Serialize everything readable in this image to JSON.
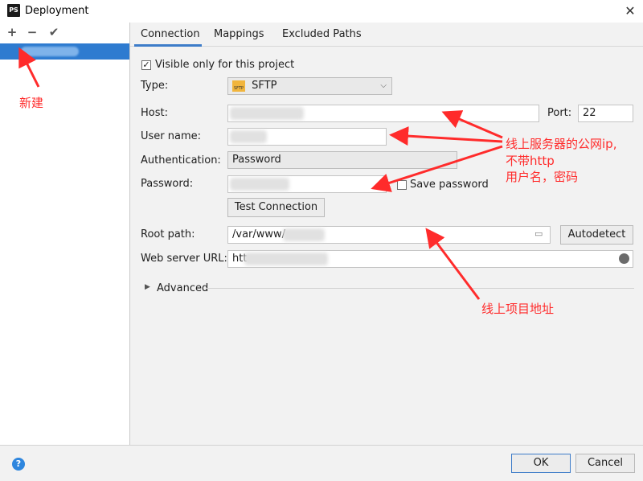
{
  "window": {
    "title": "Deployment",
    "app_icon": "PS",
    "close": "✕"
  },
  "toolbar": {
    "add": "+",
    "remove": "−",
    "apply": "✔"
  },
  "tabs": [
    {
      "label": "Connection",
      "active": true
    },
    {
      "label": "Mappings"
    },
    {
      "label": "Excluded Paths"
    }
  ],
  "form": {
    "visible_only_label": "Visible only for this project",
    "visible_only_checked": true,
    "type_label": "Type:",
    "type_value": "SFTP",
    "type_badge": "SFTP",
    "host_label": "Host:",
    "port_label": "Port:",
    "port_value": "22",
    "username_label": "User name:",
    "auth_label": "Authentication:",
    "auth_value": "Password",
    "password_label": "Password:",
    "save_password_label": "Save password",
    "test_connection_label": "Test Connection",
    "root_path_label": "Root path:",
    "root_path_value": "/var/www/",
    "autodetect_label": "Autodetect",
    "web_url_label": "Web server URL:",
    "web_url_value": "htt",
    "advanced_label": "Advanced"
  },
  "annotations": {
    "new": "新建",
    "server_line1": "线上服务器的公网ip,",
    "server_line2": "不带http",
    "server_line3": "用户名，密码",
    "project_address": "线上项目地址"
  },
  "footer": {
    "help": "?",
    "ok": "OK",
    "cancel": "Cancel"
  },
  "colors": {
    "accent": "#2e7bd0",
    "annotation": "#ff2b2b"
  }
}
